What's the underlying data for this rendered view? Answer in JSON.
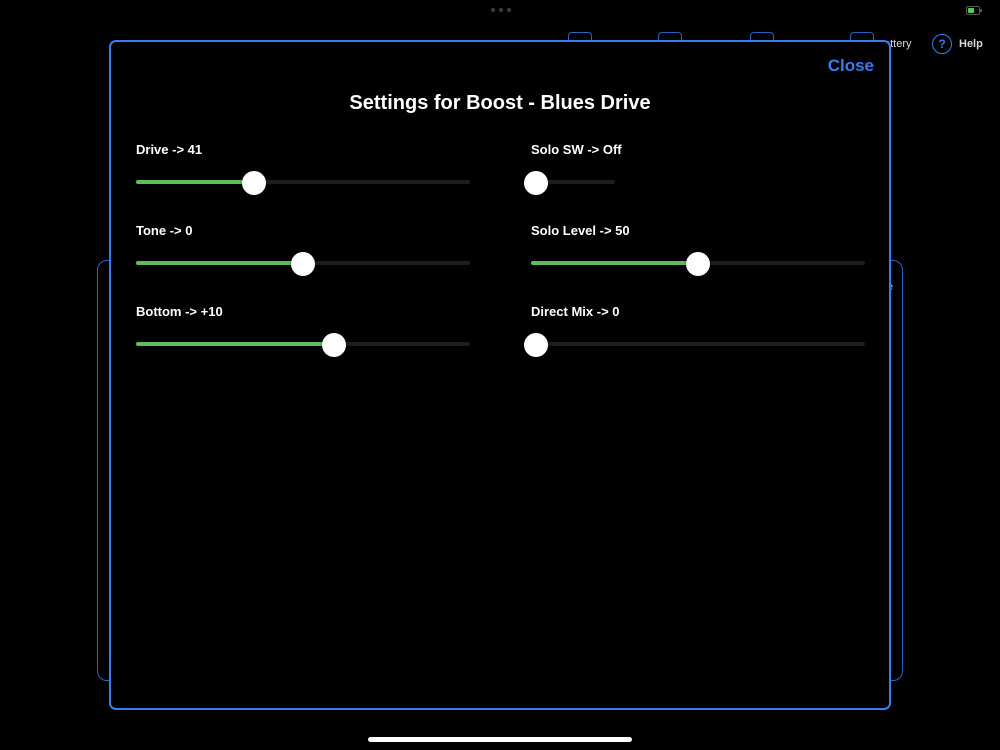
{
  "background": {
    "battery_label": "attery",
    "help_label": "Help",
    "help_glyph": "?",
    "panel_char": "e"
  },
  "modal": {
    "title": "Settings for Boost - Blues Drive",
    "close_label": "Close"
  },
  "parameters": {
    "drive": {
      "label": "Drive -> 41",
      "level": 0.35
    },
    "tone": {
      "label": "Tone -> 0",
      "level": 0.5
    },
    "bottom": {
      "label": "Bottom -> +10",
      "level": 0.595
    },
    "solo_sw": {
      "label": "Solo SW -> Off",
      "level": 0.0
    },
    "solo_level": {
      "label": "Solo Level -> 50",
      "level": 0.5
    },
    "direct_mix": {
      "label": "Direct Mix -> 0",
      "level": 0.0
    }
  },
  "colors": {
    "accent": "#3b7bf0",
    "slider_fill": "#5cbf5c",
    "slider_track": "#1e1e1e"
  }
}
